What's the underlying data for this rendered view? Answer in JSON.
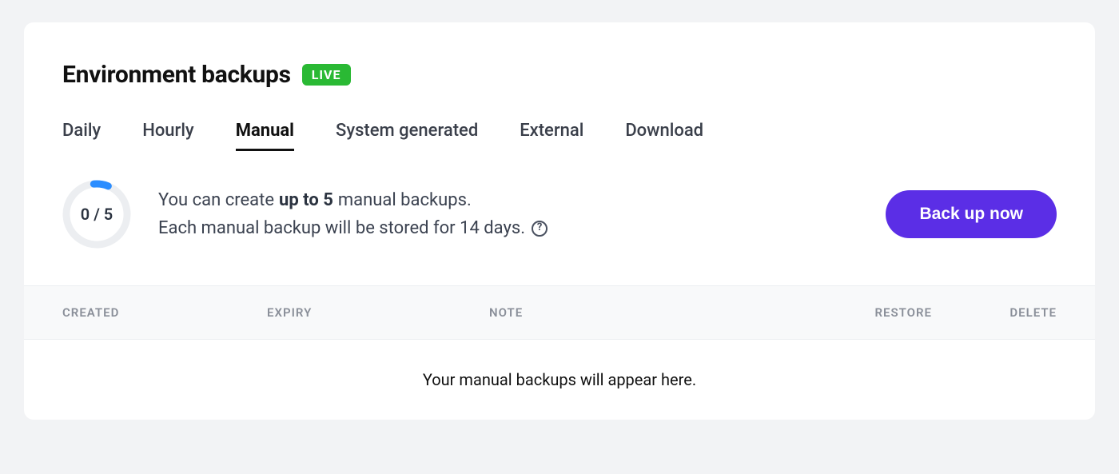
{
  "header": {
    "title": "Environment backups",
    "badge": "LIVE"
  },
  "tabs": {
    "daily": "Daily",
    "hourly": "Hourly",
    "manual": "Manual",
    "system_generated": "System generated",
    "external": "External",
    "download": "Download"
  },
  "progress": {
    "label": "0 / 5",
    "used": 0,
    "total": 5
  },
  "description": {
    "line1_pre": "You can create",
    "line1_bold": "up to 5",
    "line1_post": "manual backups.",
    "line2": "Each manual backup will be stored for 14 days."
  },
  "actions": {
    "backup_now": "Back up now"
  },
  "table": {
    "headers": {
      "created": "CREATED",
      "expiry": "EXPIRY",
      "note": "NOTE",
      "restore": "RESTORE",
      "delete": "DELETE"
    },
    "empty_message": "Your manual backups will appear here."
  }
}
